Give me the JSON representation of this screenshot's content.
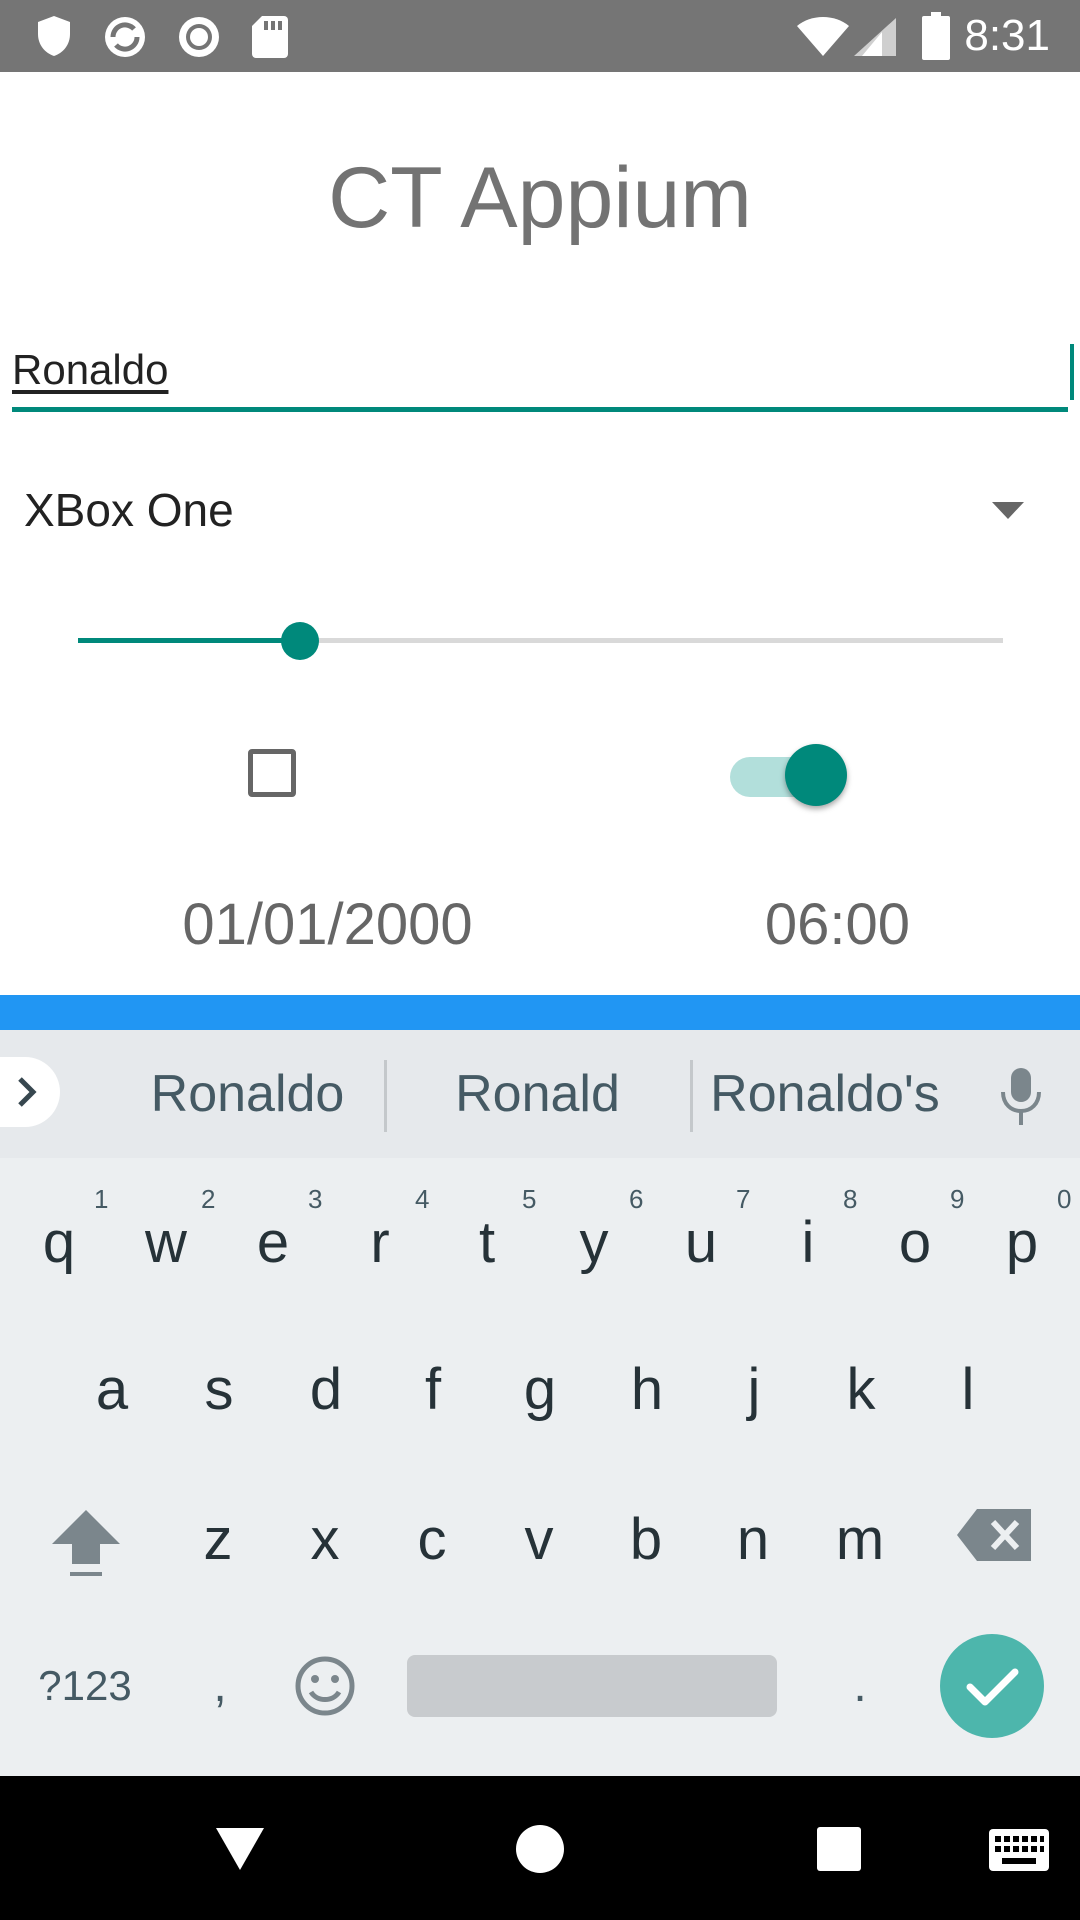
{
  "status_bar": {
    "time": "8:31",
    "left_icons": [
      "shield-icon",
      "sync-icon",
      "record-icon",
      "sd-card-icon"
    ],
    "right_icons": [
      "wifi-icon",
      "signal-icon",
      "battery-icon"
    ]
  },
  "app": {
    "title": "CT Appium",
    "name_input": {
      "value": "Ronaldo"
    },
    "spinner": {
      "selected": "XBox One"
    },
    "slider": {
      "value_fraction": 0.24
    },
    "checkbox": {
      "checked": false
    },
    "switch": {
      "on": true
    },
    "date": "01/01/2000",
    "time": "06:00",
    "accent_color": "#00897b"
  },
  "keyboard": {
    "suggestions": [
      "Ronaldo",
      "Ronald",
      "Ronaldo's"
    ],
    "row1": [
      "q",
      "w",
      "e",
      "r",
      "t",
      "y",
      "u",
      "i",
      "o",
      "p"
    ],
    "row1_hints": [
      "1",
      "2",
      "3",
      "4",
      "5",
      "6",
      "7",
      "8",
      "9",
      "0"
    ],
    "row2": [
      "a",
      "s",
      "d",
      "f",
      "g",
      "h",
      "j",
      "k",
      "l"
    ],
    "row3": [
      "z",
      "x",
      "c",
      "v",
      "b",
      "n",
      "m"
    ],
    "symbols_key": "?123",
    "comma_key": ",",
    "period_key": ".",
    "colors": {
      "top_bar": "#2196f3",
      "enter": "#4db6ac"
    }
  },
  "nav_bar": {
    "icons": [
      "back-icon",
      "home-icon",
      "recents-icon",
      "keyboard-switch-icon"
    ]
  }
}
